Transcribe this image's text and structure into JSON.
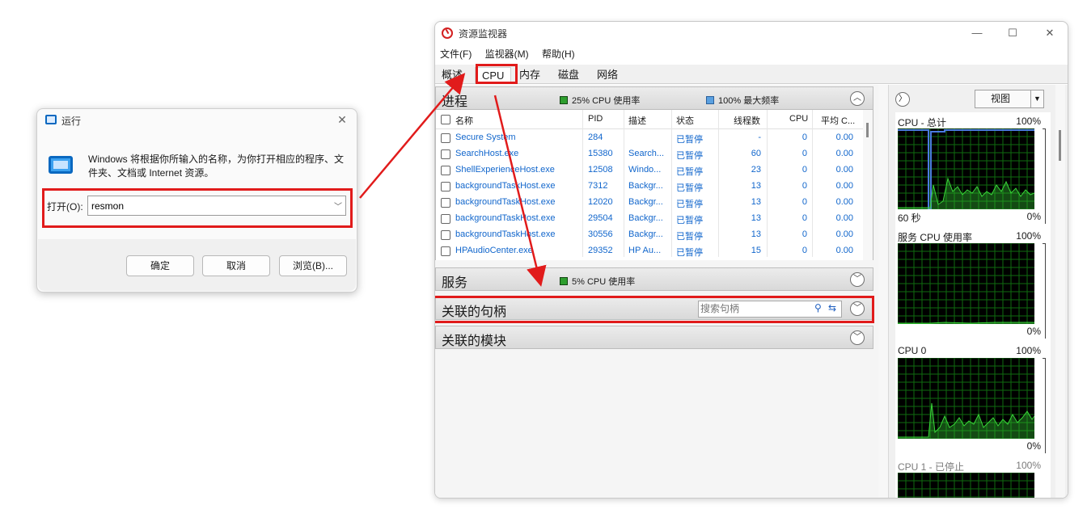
{
  "run_dialog": {
    "title": "运行",
    "close_glyph": "✕",
    "description": "Windows 将根据你所输入的名称，为你打开相应的程序、文件夹、文档或 Internet 资源。",
    "open_label": "打开(O):",
    "open_value": "resmon",
    "ok_label": "确定",
    "cancel_label": "取消",
    "browse_label": "浏览(B)..."
  },
  "resmon": {
    "title": "资源监视器",
    "window_controls": {
      "minimize": "—",
      "maximize": "☐",
      "close": "✕"
    },
    "menu": [
      "文件(F)",
      "监视器(M)",
      "帮助(H)"
    ],
    "tabs": [
      "概述",
      "CPU",
      "内存",
      "磁盘",
      "网络"
    ],
    "active_tab": "CPU",
    "processes": {
      "title": "进程",
      "stat1": "25% CPU 使用率",
      "stat2": "100% 最大频率",
      "columns": [
        "名称",
        "PID",
        "描述",
        "状态",
        "线程数",
        "CPU",
        "平均 C..."
      ],
      "rows": [
        {
          "name": "Secure System",
          "pid": "284",
          "desc": "",
          "status": "已暂停",
          "threads": "-",
          "cpu": "0",
          "avg": "0.00"
        },
        {
          "name": "SearchHost.exe",
          "pid": "15380",
          "desc": "Search...",
          "status": "已暂停",
          "threads": "60",
          "cpu": "0",
          "avg": "0.00"
        },
        {
          "name": "ShellExperienceHost.exe",
          "pid": "12508",
          "desc": "Windo...",
          "status": "已暂停",
          "threads": "23",
          "cpu": "0",
          "avg": "0.00"
        },
        {
          "name": "backgroundTaskHost.exe",
          "pid": "7312",
          "desc": "Backgr...",
          "status": "已暂停",
          "threads": "13",
          "cpu": "0",
          "avg": "0.00"
        },
        {
          "name": "backgroundTaskHost.exe",
          "pid": "12020",
          "desc": "Backgr...",
          "status": "已暂停",
          "threads": "13",
          "cpu": "0",
          "avg": "0.00"
        },
        {
          "name": "backgroundTaskHost.exe",
          "pid": "29504",
          "desc": "Backgr...",
          "status": "已暂停",
          "threads": "13",
          "cpu": "0",
          "avg": "0.00"
        },
        {
          "name": "backgroundTaskHost.exe",
          "pid": "30556",
          "desc": "Backgr...",
          "status": "已暂停",
          "threads": "13",
          "cpu": "0",
          "avg": "0.00"
        },
        {
          "name": "HPAudioCenter.exe",
          "pid": "29352",
          "desc": "HP Au...",
          "status": "已暂停",
          "threads": "15",
          "cpu": "0",
          "avg": "0.00"
        }
      ]
    },
    "services": {
      "title": "服务",
      "stat": "5% CPU 使用率"
    },
    "handles": {
      "title": "关联的句柄",
      "search_placeholder": "搜索句柄"
    },
    "modules": {
      "title": "关联的模块"
    },
    "right_panel": {
      "view_label": "视图",
      "graphs": [
        {
          "title": "CPU - 总计",
          "max": "100%",
          "footer_left": "60 秒",
          "footer_right": "0%"
        },
        {
          "title": "服务 CPU 使用率",
          "max": "100%",
          "footer_left": "",
          "footer_right": "0%"
        },
        {
          "title": "CPU 0",
          "max": "100%",
          "footer_left": "",
          "footer_right": "0%"
        },
        {
          "title": "CPU 1 - 已停止",
          "max": "100%",
          "footer_left": "",
          "footer_right": ""
        }
      ]
    },
    "colors": {
      "cpu_usage_swatch": "#2e9e2e",
      "max_freq_swatch": "#5aa0e0",
      "graph_line": "#39d639",
      "graph_grid": "#0f6b0f",
      "highlight": "#e11b1b",
      "link_blue": "#1166cc"
    }
  }
}
